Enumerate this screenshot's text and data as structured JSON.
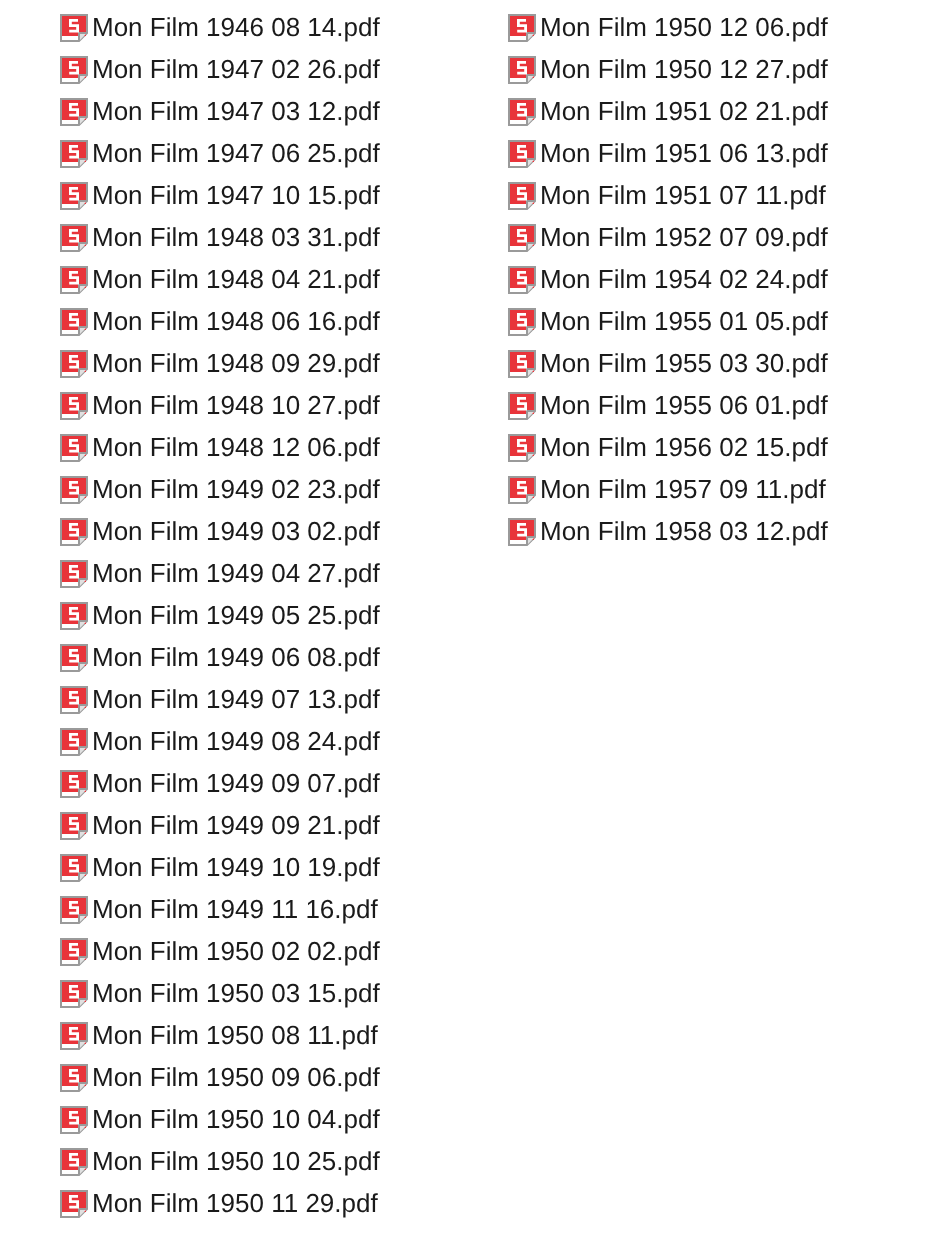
{
  "columns": [
    {
      "files": [
        "Mon Film 1946 08 14.pdf",
        "Mon Film 1947 02 26.pdf",
        "Mon Film 1947 03 12.pdf",
        "Mon Film 1947 06 25.pdf",
        "Mon Film 1947 10 15.pdf",
        "Mon Film 1948 03 31.pdf",
        "Mon Film 1948 04 21.pdf",
        "Mon Film 1948 06 16.pdf",
        "Mon Film 1948 09 29.pdf",
        "Mon Film 1948 10 27.pdf",
        "Mon Film 1948 12 06.pdf",
        "Mon Film 1949 02 23.pdf",
        "Mon Film 1949 03 02.pdf",
        "Mon Film 1949 04 27.pdf",
        "Mon Film 1949 05 25.pdf",
        "Mon Film 1949 06 08.pdf",
        "Mon Film 1949 07 13.pdf",
        "Mon Film 1949 08 24.pdf",
        "Mon Film 1949 09 07.pdf",
        "Mon Film 1949 09 21.pdf",
        "Mon Film 1949 10 19.pdf",
        "Mon Film 1949 11 16.pdf",
        "Mon Film 1950 02 02.pdf",
        "Mon Film 1950 03 15.pdf",
        "Mon Film 1950 08 11.pdf",
        "Mon Film 1950 09 06.pdf",
        "Mon Film 1950 10 04.pdf",
        "Mon Film 1950 10 25.pdf",
        "Mon Film 1950 11 29.pdf"
      ]
    },
    {
      "files": [
        "Mon Film 1950 12 06.pdf",
        "Mon Film 1950 12 27.pdf",
        "Mon Film 1951 02 21.pdf",
        "Mon Film 1951 06 13.pdf",
        "Mon Film 1951 07 11.pdf",
        "Mon Film 1952 07 09.pdf",
        "Mon Film 1954 02 24.pdf",
        "Mon Film 1955 01 05.pdf",
        "Mon Film 1955 03 30.pdf",
        "Mon Film 1955 06 01.pdf",
        "Mon Film 1956 02 15.pdf",
        "Mon Film 1957 09 11.pdf",
        "Mon Film 1958 03 12.pdf"
      ]
    }
  ]
}
